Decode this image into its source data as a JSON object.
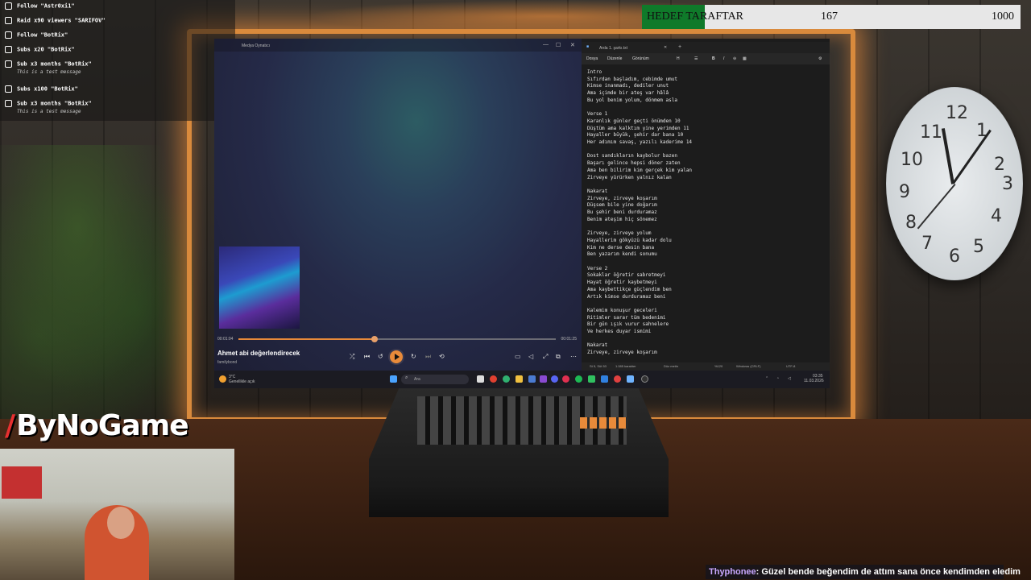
{
  "alerts": [
    {
      "title": "Follow \"Astr0xi1\"",
      "message": "",
      "icon": "follow-icon"
    },
    {
      "title": "Raid x90 viewers \"SARIFOV\"",
      "message": "",
      "icon": "raid-icon"
    },
    {
      "title": "Follow \"BotRix\"",
      "message": "",
      "icon": "follow-icon"
    },
    {
      "title": "Subs x20 \"BotRix\"",
      "message": "",
      "icon": "sub-icon"
    },
    {
      "title": "Sub x3 months \"BotRix\"",
      "message": "This is a test message",
      "icon": "star-icon"
    },
    {
      "title": "Subs x100 \"BotRix\"",
      "message": "",
      "icon": "sub-icon"
    },
    {
      "title": "Sub x3 months \"BotRix\"",
      "message": "This is a test message",
      "icon": "star-icon"
    }
  ],
  "goal": {
    "label": "HEDEF TARAFTAR",
    "current": "167",
    "target": "1000",
    "progress_fraction": 0.167,
    "fill_color": "#0f7a2a"
  },
  "media_player": {
    "window_title": "Medya Oynatıcı",
    "song_title": "Ahmet abi değerlendirecek",
    "artist": "familybond",
    "elapsed": "00:01:04",
    "total": "00:01:25",
    "progress_fraction": 0.43,
    "accent_color": "#e88a3a"
  },
  "notepad": {
    "tab_title": "Arda 1. şarkı.txt",
    "menu": [
      "Dosya",
      "Düzenle",
      "Görünüm"
    ],
    "content": "Intro\nSıfırdan başladım, cebimde umut\nKimse inanmadı, dediler unut\nAma içimde bir ateş var hâlâ\nBu yol benim yolum, dönmem asla\n\nVerse 1\nKaranlık günler geçti önümden 10\nDüştüm ama kalktım yine yerimden 11\nHayaller büyük, şehir dar bana 10\nHer adımım savaş, yazılı kaderime 14\n\nDost sandıkların kaybolur bazen\nBaşarı gelince hepsi döner zaten\nAma ben bilirim kim gerçek kim yalan\nZirveye yürürken yalnız kalan\n\nNakarat\nZirveye, zirveye koşarım\nDüşsem bile yine doğarım\nBu şehir beni durduramaz\nBenim ateşim hiç sönemez\n\nZirveye, zirveye yolum\nHayallerim gökyüzü kadar dolu\nKim ne derse desin bana\nBen yazarım kendi sonumu\n\nVerse 2\nSokaklar öğretir sabretmeyi\nHayat öğretir kaybetmeyi\nAma kaybettikçe güçlendim ben\nArtık kimse durduramaz beni\n\nKalemim konuşur geceleri\nRitimler sarar tüm bedenimi\nBir gün ışık vurur sahnelere\nVe herkes duyar ismimi\n\nNakarat\nZirveye, zirveye koşarım",
    "status": {
      "position": "St 5, Süt 53",
      "chars": "1.085 karakter",
      "format": "Düz metin",
      "zoom": "%120",
      "line_endings": "Windows (CRLF)",
      "encoding": "UTF-8"
    }
  },
  "taskbar": {
    "weather_temp": "3°C",
    "weather_text": "Genellikle açık",
    "search_placeholder": "Ara",
    "time": "03:35",
    "date": "11.03.2026"
  },
  "logo": {
    "text": "ByNoGame",
    "accent_color": "#e63030"
  },
  "chat": {
    "user": "Thyphonee",
    "message": ": Güzel bende beğendim de attım sana önce kendimden eledim",
    "user_color": "#c9a8ff"
  }
}
